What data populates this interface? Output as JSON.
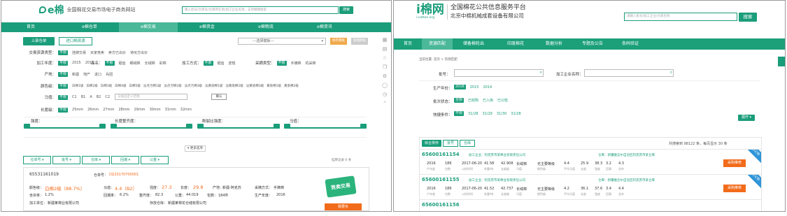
{
  "left": {
    "logo": {
      "mark": "e棉",
      "tagline": "全国棉花交易市场电子商务网站"
    },
    "search": {
      "placeholder": "输入批号/仓库名/仓库所在地/加工企业名称，支持模糊搜索",
      "button": "搜索"
    },
    "nav": [
      "首页",
      "e棉仓单",
      "e棉交易",
      "e棉资金",
      "e棉物流",
      "e棉资讯"
    ],
    "tabs": [
      "上架仓单",
      "进口棉资源"
    ],
    "dropdown": "---选择模板---",
    "save_button": "保存模板",
    "manage_button": "管理模板",
    "filters": [
      {
        "label": "交易资源类型：",
        "tag": "不限",
        "options": [
          "挂牌交易",
          "买家竞卖",
          "卖方已出价",
          "待买方出价"
        ]
      },
      {
        "label": "加工年度：",
        "tag": "不限",
        "options": [
          "2015",
          "2016"
        ]
      },
      {
        "label": "品名：",
        "tag": "不限",
        "options": [
          "锯齿",
          "细绒棉",
          "长绒棉",
          "彩棉"
        ]
      },
      {
        "label": "加工方式：",
        "tag": "不限",
        "options": [
          "锯齿",
          "皮辊"
        ]
      },
      {
        "label": "采摘类型：",
        "tag": "不限",
        "options": [
          "手摘棉",
          "机采棉"
        ]
      },
      {
        "label": "产地：",
        "tag": "不限",
        "options": [
          "新疆",
          "地产",
          "进口",
          "兵团"
        ]
      },
      {
        "label": "颜色级：",
        "tag": "不限",
        "options": [
          "白棉1级",
          "白棉2级",
          "白棉3级",
          "白棉4级",
          "白棉5级",
          "淡点污棉1级",
          "淡点污棉2级",
          "淡点污棉3级",
          "淡黄染棉1级",
          "淡黄染棉2级",
          "淡黄染棉3级",
          "黄染棉1级",
          "黄染棉2级"
        ]
      },
      {
        "label": "马值：",
        "tag": "不限",
        "options": [
          "C1",
          "B1",
          "A",
          "B2",
          "C2"
        ]
      },
      {
        "label": "长度级：",
        "tag": "不限",
        "options": [
          "25mm",
          "26mm",
          "27mm",
          "28mm",
          "29mm",
          "30mm",
          "31mm",
          "32mm"
        ]
      }
    ],
    "mic_placeholder": "马值自定义范围",
    "mic_confirm": "确认",
    "sliders": [
      "强度：",
      "长度整齐度：",
      "断裂比强度：",
      "马值："
    ],
    "sort": [
      "仓单号",
      "批号",
      "仓库",
      "回潮",
      "公重"
    ],
    "more": "更多选项",
    "listing_count": "挂牌记录 0 条",
    "card": {
      "id": "65531161019",
      "cert_label": "仓单号：",
      "cert": "DZ20170700001",
      "grade_label": "颜色级：",
      "grade": "白棉2级（88.7%）",
      "mic_label": "马值：",
      "mic": "4.4（B2）",
      "str_label": "强度：",
      "str": "27.3",
      "len_label": "长度：",
      "len": "29.8",
      "region_label": "产地：",
      "region": "新疆-阿克苏",
      "pick_label": "采摘方式：",
      "pick": "手摘棉",
      "trash_label": "含杂率：",
      "trash": "1.2%",
      "moisture_label": "回潮率：",
      "moisture": "6.2%",
      "uniform_label": "整齐度：",
      "uniform": "82.3",
      "net_label": "公重：",
      "net": "44.019",
      "count_label": "包数：",
      "count": "184件",
      "year_label": "生产年度：",
      "year": "2016",
      "maker_label": "加工单位：",
      "maker": "新疆某棉业有限公司",
      "warehouse_label": "存放仓库：",
      "warehouse": "新疆某棉花仓储有限公司",
      "badge": "竞卖交易",
      "action": "我要买"
    }
  },
  "right": {
    "logo": {
      "mark": "i棉网",
      "sub": "i-cotton.org",
      "title": "全国棉花公共信息服务平台",
      "company": "北京中棉机械成套设备有限公司"
    },
    "search": {
      "placeholder": "请输入批号/加工企业/仓库名称",
      "button": "搜索"
    },
    "nav": [
      "首页",
      "资源匹配",
      "储备棉轮出",
      "印度棉花",
      "数据分析",
      "专题及公告",
      "条码验证"
    ],
    "breadcrumb": "当前位置: 首页 > 资源匹配",
    "lot_label": "批号：",
    "maker_label": "加工企业名称：",
    "year_label": "生产年份：",
    "years": [
      "2016",
      "2015",
      "2014"
    ],
    "status_label": "批次状态：",
    "statuses": [
      "全部",
      "已收购",
      "已入库",
      "已公检"
    ],
    "quick_label": "快捷条件：",
    "quick": [
      "不限",
      "31/28",
      "31/29",
      "31/30",
      "31/28"
    ],
    "expand": "展开",
    "sort_tabs": [
      "综合排序",
      "批号",
      "仓库"
    ],
    "summary": "共搜索到 98122 条，每页显示 30 条",
    "header_sub": [
      "产年度",
      "包数",
      "公检时间",
      "毛重/吨",
      "长度级",
      "马值",
      "颜色级",
      "平均马值",
      "长度",
      "强度",
      "回潮",
      "含杂"
    ],
    "rows": [
      {
        "lot": "65600161154",
        "maker": "加工企业：阿克苏市某棉业有限责任公司",
        "wh": "仓库：新疆维吾尔自治区阿克苏市某仓库",
        "vals": [
          "2016",
          "186",
          "2017-06-20",
          "41.58",
          "42.908",
          "长绒棉",
          "无主要等级",
          "4.4",
          "25.9",
          "38.3",
          "3.2",
          "4.3"
        ],
        "action": "采购推荐",
        "ribbon": "已公检"
      },
      {
        "lot": "65600161155",
        "maker": "加工企业：阿克苏市某棉业有限责任公司",
        "wh": "仓库：新疆维吾尔自治区阿克苏市某仓库",
        "vals": [
          "2016",
          "186",
          "2017-06-20",
          "41.52",
          "42.737",
          "长绒棉",
          "无主要等级",
          "4.2",
          "36.1",
          "37.6",
          "3.4",
          "4.4"
        ],
        "action": "采购推荐",
        "ribbon": "已公检"
      },
      {
        "lot": "65600161156",
        "maker": "",
        "wh": "",
        "vals": [],
        "action": "",
        "ribbon": ""
      }
    ]
  },
  "colors": {
    "brand": "#1a9d7a",
    "accent": "#f26b1a"
  }
}
